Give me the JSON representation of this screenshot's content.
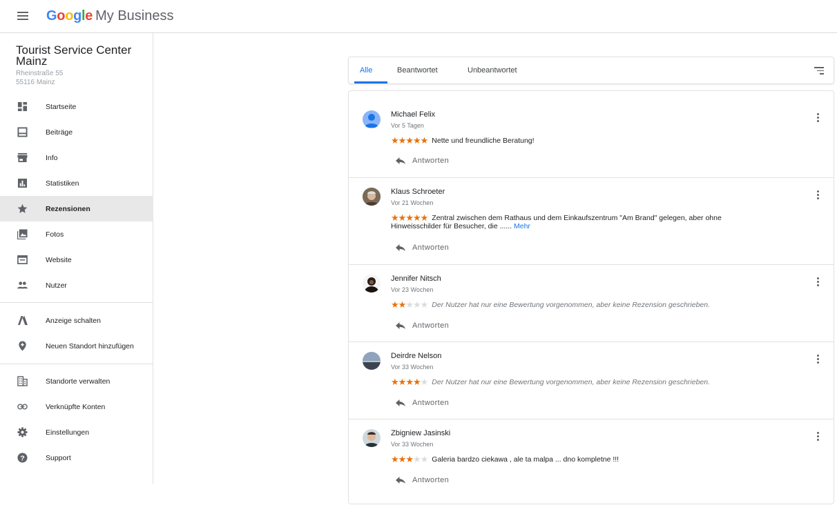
{
  "header": {
    "logo_google": "Google",
    "logo_product": "My Business",
    "google_colors": [
      "#4285F4",
      "#EA4335",
      "#FBBC05",
      "#4285F4",
      "#34A853",
      "#EA4335"
    ]
  },
  "business": {
    "name": "Tourist Service Center Mainz",
    "address_line1": "Rheinstraße 55",
    "address_line2": "55116 Mainz"
  },
  "sidebar": {
    "items": [
      {
        "label": "Startseite",
        "icon": "dashboard-icon"
      },
      {
        "label": "Beiträge",
        "icon": "posts-icon"
      },
      {
        "label": "Info",
        "icon": "store-icon"
      },
      {
        "label": "Statistiken",
        "icon": "insights-icon"
      },
      {
        "label": "Rezensionen",
        "icon": "star-icon",
        "active": true
      },
      {
        "label": "Fotos",
        "icon": "photos-icon"
      },
      {
        "label": "Website",
        "icon": "website-icon"
      },
      {
        "label": "Nutzer",
        "icon": "users-icon"
      },
      {
        "label": "Anzeige schalten",
        "icon": "ads-icon"
      },
      {
        "label": "Neuen Standort hinzufügen",
        "icon": "add-location-icon"
      },
      {
        "label": "Standorte verwalten",
        "icon": "buildings-icon"
      },
      {
        "label": "Verknüpfte Konten",
        "icon": "link-icon"
      },
      {
        "label": "Einstellungen",
        "icon": "gear-icon"
      },
      {
        "label": "Support",
        "icon": "help-icon"
      }
    ]
  },
  "tabs": [
    {
      "label": "Alle",
      "active": true
    },
    {
      "label": "Beantwortet"
    },
    {
      "label": "Unbeantwortet"
    }
  ],
  "reply_label": "Antworten",
  "reviews": [
    {
      "name": "Michael Felix",
      "time": "Vor 5 Tagen",
      "rating": 5,
      "text": "Nette und freundliche Beratung!"
    },
    {
      "name": "Klaus Schroeter",
      "time": "Vor 21 Wochen",
      "rating": 5,
      "text": "Zentral zwischen dem Rathaus und dem Einkaufszentrum \"Am Brand\" gelegen, aber ohne",
      "text2": "Hinweisschilder für Besucher, die ......",
      "more": "Mehr"
    },
    {
      "name": "Jennifer Nitsch",
      "time": "Vor 23 Wochen",
      "rating": 2,
      "text": "Der Nutzer hat nur eine Bewertung vorgenommen, aber keine Rezension geschrieben.",
      "no_text": true
    },
    {
      "name": "Deirdre Nelson",
      "time": "Vor 33 Wochen",
      "rating": 4,
      "text": "Der Nutzer hat nur eine Bewertung vorgenommen, aber keine Rezension geschrieben.",
      "no_text": true
    },
    {
      "name": "Zbigniew Jasinski",
      "time": "Vor 33 Wochen",
      "rating": 3,
      "text": "Galeria bardzo ciekawa , ale ta malpa ... dno kompletne !!!"
    }
  ],
  "colors": {
    "accent": "#1a73e8",
    "star": "#e8710a",
    "star_empty": "#dadce0"
  }
}
